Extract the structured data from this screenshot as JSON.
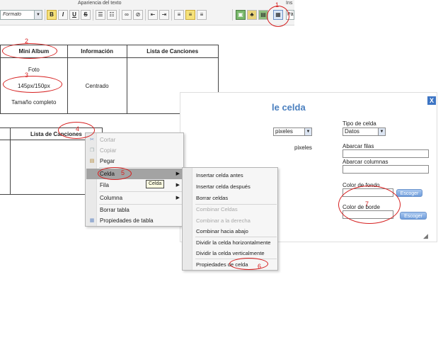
{
  "toolbar": {
    "caption": "Apariencia del texto",
    "caption_right": "Ins",
    "format_select": "Formato",
    "bold": "B",
    "italic": "I",
    "underline": "U",
    "strike": "S",
    "font_select_partial": "Pá"
  },
  "table_top": {
    "headers": [
      "Mini Album",
      "Información",
      "Lista de Canciones"
    ],
    "cells": {
      "foto": "Foto",
      "size": "145px/150px",
      "full": "Tamaño completo",
      "centered": "Centrado"
    }
  },
  "table_bottom": {
    "header": "Lista de Canciones"
  },
  "context_menu": {
    "items": [
      {
        "label": "Cortar",
        "disabled": true,
        "icon": "scissors-icon"
      },
      {
        "label": "Copiar",
        "disabled": true,
        "icon": "copy-icon"
      },
      {
        "label": "Pegar",
        "disabled": false,
        "icon": "paste-icon"
      },
      {
        "label": "Celda",
        "disabled": false,
        "highlighted": true,
        "submenu": true
      },
      {
        "label": "Fila",
        "disabled": false,
        "submenu": true
      },
      {
        "label": "Columna",
        "disabled": false,
        "submenu": true
      },
      {
        "label": "Borrar tabla",
        "disabled": false
      },
      {
        "label": "Propiedades de tabla",
        "disabled": false,
        "icon": "table-properties-icon"
      }
    ],
    "submenu_arrow": "▶"
  },
  "tooltip": "Celda",
  "cell_submenu": {
    "items": [
      {
        "label": "Insertar celda antes",
        "disabled": false
      },
      {
        "label": "Insertar celda después",
        "disabled": false
      },
      {
        "label": "Borrar celdas",
        "disabled": false
      },
      {
        "label": "Combinar Celdas",
        "disabled": true
      },
      {
        "label": "Combinar a la derecha",
        "disabled": true
      },
      {
        "label": "Combinar hacia abajo",
        "disabled": false
      },
      {
        "label": "Dividir la celda horizontalmente",
        "disabled": false
      },
      {
        "label": "Dividir la celda verticalmente",
        "disabled": false
      },
      {
        "label": "Propiedades de celda",
        "disabled": false
      }
    ]
  },
  "dialog": {
    "title": "le celda",
    "close": "X",
    "units_select": "pixeles",
    "units_text": "pixeles",
    "cell_type_label": "Tipo de celda",
    "cell_type_value": "Datos",
    "rowspan_label": "Abarcar filas",
    "colspan_label": "Abarcar columnas",
    "bg_color_label": "Color de fondo",
    "border_color_label": "Color de borde",
    "choose_button": "Escoger"
  },
  "annotations": [
    "1",
    "2",
    "3",
    "4",
    "5",
    "6",
    "7"
  ],
  "colors": {
    "annotation": "#d62020",
    "dialog_title": "#4a7fbf",
    "menu_highlight": "#a3a3a3",
    "button_blue": "#6f9ddb"
  }
}
